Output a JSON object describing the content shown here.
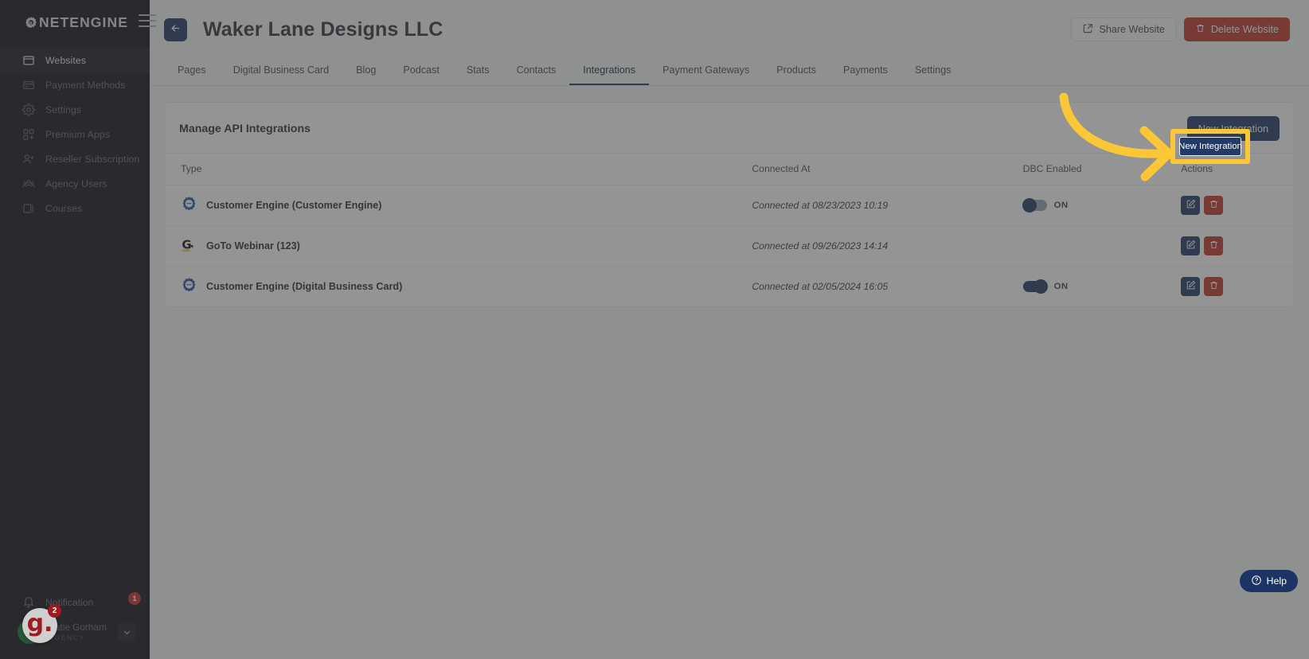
{
  "app": {
    "brand": "NETENGINE",
    "brand_icon": "gear-logo-icon",
    "menu_icon": "hamburger-menu-icon"
  },
  "sidebar": {
    "items": [
      {
        "label": "Websites",
        "icon": "browser-window-icon",
        "active": true
      },
      {
        "label": "Payment Methods",
        "icon": "credit-card-icon",
        "active": false
      },
      {
        "label": "Settings",
        "icon": "gear-icon",
        "active": false
      },
      {
        "label": "Premium Apps",
        "icon": "apps-grid-icon",
        "active": false
      },
      {
        "label": "Reseller Subscription",
        "icon": "user-plus-icon",
        "active": false
      },
      {
        "label": "Agency Users",
        "icon": "users-group-icon",
        "active": false
      },
      {
        "label": "Courses",
        "icon": "book-icon",
        "active": false
      }
    ],
    "notification": {
      "label": "Notification",
      "icon": "bell-icon",
      "badge": "1"
    },
    "user": {
      "initials": "K",
      "name": "Katie Gorham",
      "org": "AGENCY",
      "caret_icon": "chevron-down-icon"
    },
    "widget": {
      "logo": "g.",
      "badge": "2"
    }
  },
  "header": {
    "back_icon": "arrow-left-icon",
    "title": "Waker Lane Designs LLC",
    "share_label": "Share Website",
    "share_icon": "share-icon",
    "delete_label": "Delete Website",
    "delete_icon": "trash-icon"
  },
  "tabs": [
    {
      "label": "Pages",
      "active": false
    },
    {
      "label": "Digital Business Card",
      "active": false
    },
    {
      "label": "Blog",
      "active": false
    },
    {
      "label": "Podcast",
      "active": false
    },
    {
      "label": "Stats",
      "active": false
    },
    {
      "label": "Contacts",
      "active": false
    },
    {
      "label": "Integrations",
      "active": true
    },
    {
      "label": "Payment Gateways",
      "active": false
    },
    {
      "label": "Products",
      "active": false
    },
    {
      "label": "Payments",
      "active": false
    },
    {
      "label": "Settings",
      "active": false
    }
  ],
  "card": {
    "title": "Manage API Integrations",
    "new_button": "New Integration",
    "columns": [
      "Type",
      "Connected At",
      "DBC Enabled",
      "Actions"
    ],
    "rows": [
      {
        "icon": "customer-engine-icon",
        "type": "Customer Engine (Customer Engine)",
        "connected_at": "Connected at 08/23/2023 10:19",
        "dbc_enabled": true,
        "dbc_label": "ON",
        "dbc_knob": "left",
        "actions": [
          "edit",
          "delete"
        ]
      },
      {
        "icon": "goto-webinar-icon",
        "type": "GoTo Webinar (123)",
        "connected_at": "Connected at 09/26/2023 14:14",
        "dbc_enabled": false,
        "dbc_label": "",
        "dbc_knob": "",
        "actions": [
          "edit",
          "delete"
        ]
      },
      {
        "icon": "customer-engine-icon",
        "type": "Customer Engine (Digital Business Card)",
        "connected_at": "Connected at 02/05/2024 16:05",
        "dbc_enabled": true,
        "dbc_label": "ON",
        "dbc_knob": "right",
        "actions": [
          "edit",
          "delete"
        ]
      }
    ]
  },
  "overlay": {
    "highlight_target": "New Integration",
    "arrow_icon": "curved-arrow-icon",
    "arrow_color": "#fbc737",
    "highlight_color": "#fbc737",
    "dim_color": "rgba(60,60,60,0.55)"
  },
  "help": {
    "label": "Help",
    "icon": "question-circle-icon"
  },
  "colors": {
    "accent": "#223a66",
    "danger": "#c0392b",
    "sidebar_bg": "#14161d",
    "page_bg": "#f4f5f7"
  }
}
